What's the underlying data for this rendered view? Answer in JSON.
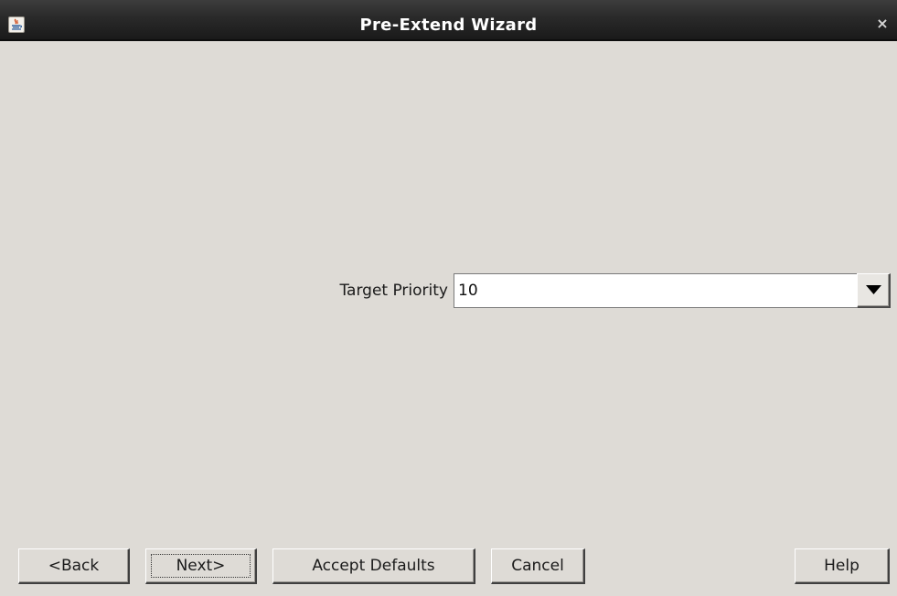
{
  "window": {
    "title": "Pre-Extend Wizard",
    "app_icon": "java-icon",
    "close_glyph": "×"
  },
  "form": {
    "target_priority": {
      "label": "Target Priority",
      "value": "10"
    }
  },
  "buttons": {
    "back": "<Back",
    "next": "Next>",
    "accept_defaults": "Accept Defaults",
    "cancel": "Cancel",
    "help": "Help"
  },
  "colors": {
    "background": "#dedbd6",
    "titlebar": "#2b2b2b",
    "title_text": "#ffffff"
  }
}
